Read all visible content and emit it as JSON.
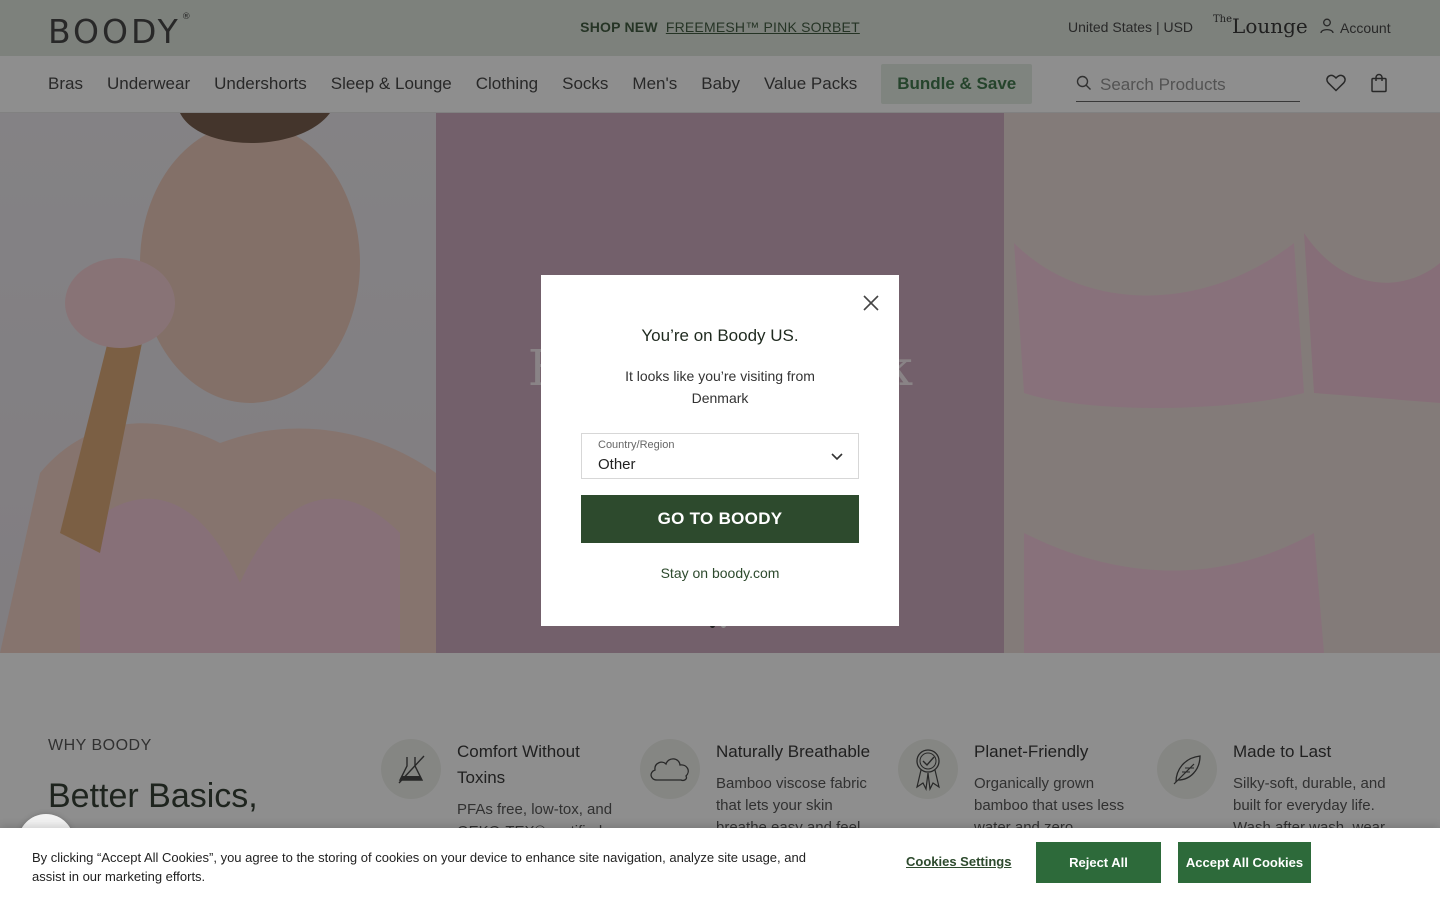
{
  "header": {
    "logo": "BOODY",
    "logo_tm": "®",
    "promo_prefix": "SHOP NEW",
    "promo_link": "FREEMESH™ PINK SORBET",
    "region": "United States | USD",
    "lounge_the": "The",
    "lounge_name": "Lounge",
    "account": "Account"
  },
  "nav": {
    "items": [
      "Bras",
      "Underwear",
      "Undershorts",
      "Sleep & Lounge",
      "Clothing",
      "Socks",
      "Men's",
      "Baby",
      "Value Packs"
    ],
    "bundle": "Bundle & Save",
    "search_placeholder": "Search Products"
  },
  "hero": {
    "title": "FreeMesh Pink Sorbet"
  },
  "why": {
    "eyebrow": "WHY BOODY",
    "title": "Better Basics,",
    "features": [
      {
        "title": "Comfort Without Toxins",
        "desc": "PFAs free, low-tox, and OEKO-TEX® certified.",
        "icon": "flask-slash-icon"
      },
      {
        "title": "Naturally Breathable",
        "desc": "Bamboo viscose fabric that lets your skin breathe easy and feel",
        "icon": "cloud-icon"
      },
      {
        "title": "Planet-Friendly",
        "desc": "Organically grown bamboo that uses less water and zero",
        "icon": "award-ribbon-icon"
      },
      {
        "title": "Made to Last",
        "desc": "Silky-soft, durable, and built for everyday life. Wash after wash, wear",
        "icon": "feather-icon"
      }
    ]
  },
  "modal": {
    "title": "You’re on Boody US.",
    "text": "It looks like you’re visiting from Denmark",
    "select_label": "Country/Region",
    "select_value": "Other",
    "go_button": "GO TO BOODY",
    "stay_link": "Stay on boody.com"
  },
  "cookie": {
    "text": "By clicking “Accept All Cookies”, you agree to the storing of cookies on your device to enhance site navigation, analyze site usage, and assist in our marketing efforts.",
    "settings": "Cookies Settings",
    "reject": "Reject All",
    "accept": "Accept All Cookies"
  },
  "colors": {
    "brand_green": "#2d4a2d",
    "button_green": "#2d6a3a",
    "topbar": "#dde5db",
    "hero_mid": "#c9a3b8"
  }
}
